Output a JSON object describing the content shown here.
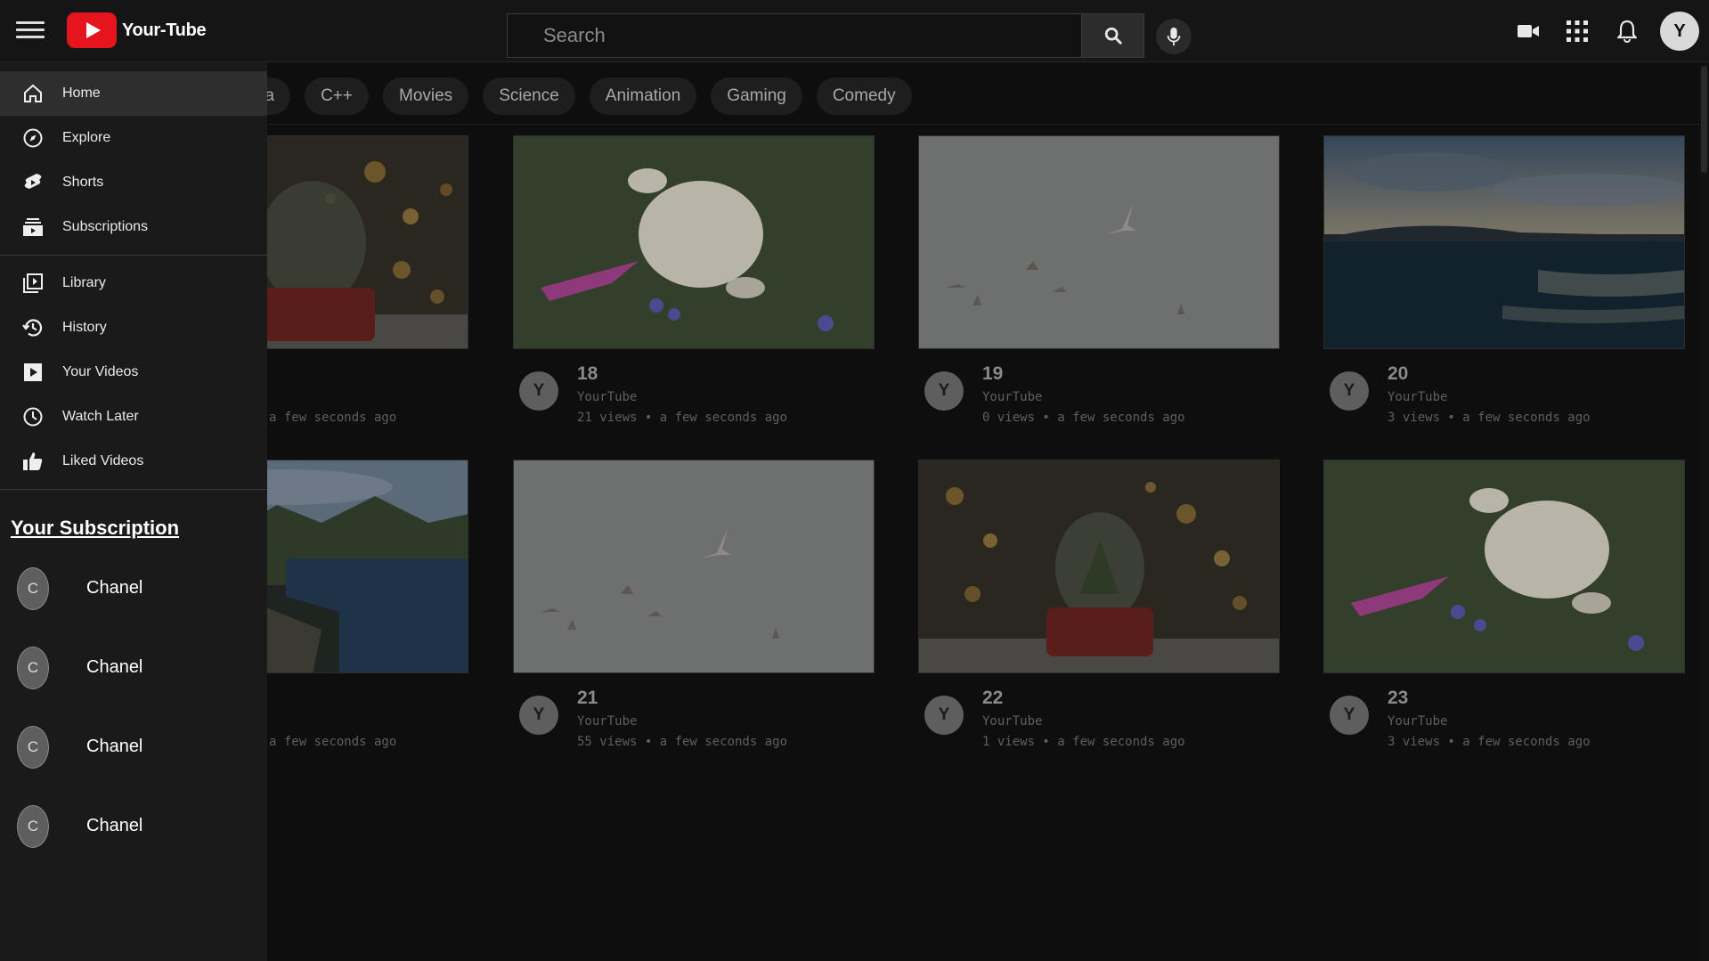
{
  "header": {
    "app_name": "Your-Tube",
    "search_placeholder": "Search",
    "user_initial": "Y"
  },
  "chips": [
    "va",
    "C++",
    "Movies",
    "Science",
    "Animation",
    "Gaming",
    "Comedy"
  ],
  "sidebar": {
    "items": [
      {
        "label": "Home",
        "icon": "home-icon",
        "active": true
      },
      {
        "label": "Explore",
        "icon": "compass-icon"
      },
      {
        "label": "Shorts",
        "icon": "shorts-icon"
      },
      {
        "label": "Subscriptions",
        "icon": "subscriptions-icon"
      },
      {
        "label": "Library",
        "icon": "library-icon"
      },
      {
        "label": "History",
        "icon": "history-icon"
      },
      {
        "label": "Your Videos",
        "icon": "play-icon"
      },
      {
        "label": "Watch Later",
        "icon": "clock-icon"
      },
      {
        "label": "Liked Videos",
        "icon": "thumbs-up-icon"
      }
    ],
    "subscriptions_heading": "Your Subscription",
    "subscriptions": [
      {
        "initial": "C",
        "name": "Chanel"
      },
      {
        "initial": "C",
        "name": "Chanel"
      },
      {
        "initial": "C",
        "name": "Chanel"
      },
      {
        "initial": "C",
        "name": "Chanel"
      }
    ]
  },
  "videos": [
    {
      "title": "",
      "channel": "",
      "stats": "a few seconds ago",
      "avatar": "",
      "thumb": "snowglobe"
    },
    {
      "title": "18",
      "channel": "YourTube",
      "stats": "21 views  • a few seconds ago",
      "avatar": "Y",
      "thumb": "bunny"
    },
    {
      "title": "19",
      "channel": "YourTube",
      "stats": "0 views  • a few seconds ago",
      "avatar": "Y",
      "thumb": "birds"
    },
    {
      "title": "20",
      "channel": "YourTube",
      "stats": "3 views  • a few seconds ago",
      "avatar": "Y",
      "thumb": "ocean"
    },
    {
      "title": "",
      "channel": "",
      "stats": "a few seconds ago",
      "avatar": "",
      "thumb": "coast"
    },
    {
      "title": "21",
      "channel": "YourTube",
      "stats": "55 views  • a few seconds ago",
      "avatar": "Y",
      "thumb": "birds"
    },
    {
      "title": "22",
      "channel": "YourTube",
      "stats": "1 views  • a few seconds ago",
      "avatar": "Y",
      "thumb": "snowglobe"
    },
    {
      "title": "23",
      "channel": "YourTube",
      "stats": "3 views  • a few seconds ago",
      "avatar": "Y",
      "thumb": "bunny"
    }
  ]
}
